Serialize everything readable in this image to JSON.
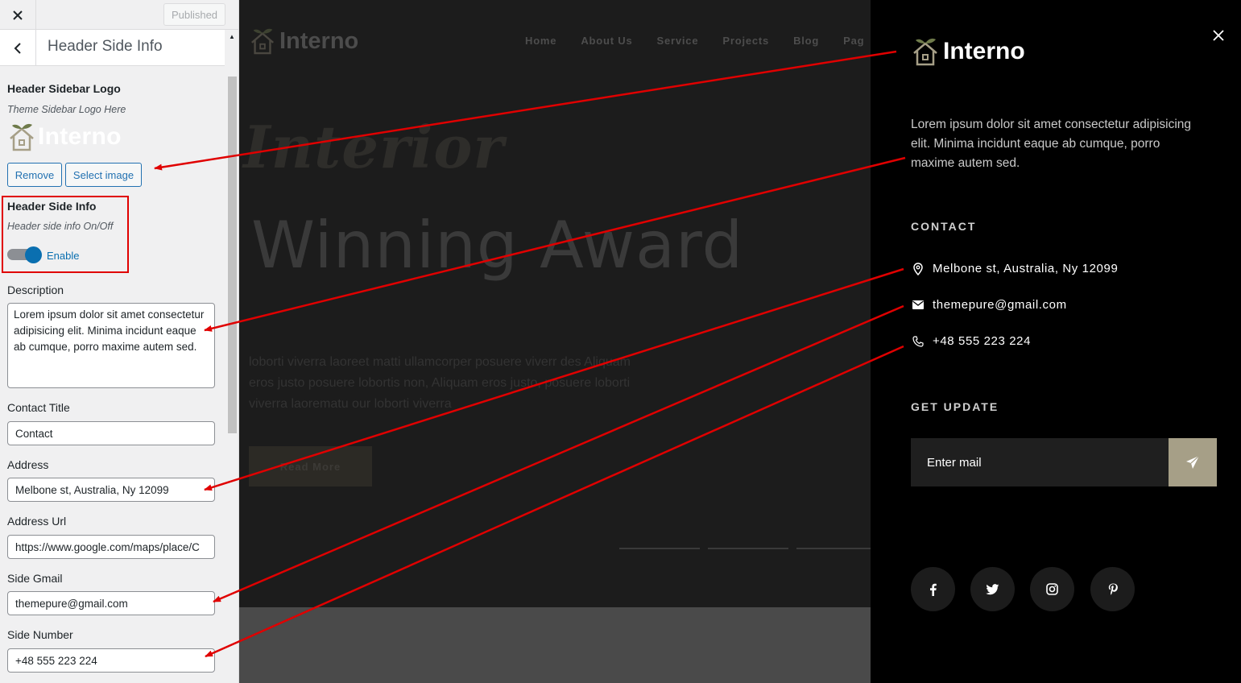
{
  "customizer": {
    "close_icon": "close-icon",
    "published_label": "Published",
    "section_title": "Header Side Info",
    "sidebar_logo": {
      "label": "Header Sidebar Logo",
      "description": "Theme Sidebar Logo Here",
      "logo_text": "Interno",
      "remove_label": "Remove",
      "select_label": "Select image"
    },
    "side_info": {
      "label": "Header Side Info",
      "description": "Header side info On/Off",
      "toggle_on": true,
      "toggle_label": "Enable"
    },
    "description": {
      "label": "Description",
      "value": "Lorem ipsum dolor sit amet consectetur adipisicing elit. Minima incidunt eaque ab cumque, porro maxime autem sed."
    },
    "contact_title": {
      "label": "Contact Title",
      "value": "Contact"
    },
    "address": {
      "label": "Address",
      "value": "Melbone st, Australia, Ny 12099"
    },
    "address_url": {
      "label": "Address Url",
      "value": "https://www.google.com/maps/place/C"
    },
    "side_gmail": {
      "label": "Side Gmail",
      "value": "themepure@gmail.com"
    },
    "side_number": {
      "label": "Side Number",
      "value": "+48 555 223 224"
    }
  },
  "preview": {
    "logo_text": "Interno",
    "nav": [
      "Home",
      "About Us",
      "Service",
      "Projects",
      "Blog",
      "Pag"
    ],
    "script_title": "Interior",
    "hero_title": "Winning Award",
    "paragraph": "loborti viverra laoreet matti ullamcorper posuere viverr des Aliquam eros justo posuere lobortis non, Aliquam eros justo, posuere loborti viverra laorematu our loborti viverra",
    "read_more": "Read More"
  },
  "side_info": {
    "logo_text": "Interno",
    "description": "Lorem ipsum dolor sit amet consectetur adipisicing elit. Minima incidunt eaque ab cumque, porro maxime autem sed.",
    "contact_heading": "CONTACT",
    "address": "Melbone st, Australia, Ny 12099",
    "email": "themepure@gmail.com",
    "phone": "+48 555 223 224",
    "update_heading": "GET UPDATE",
    "mail_placeholder": "Enter mail",
    "social": [
      "facebook-icon",
      "twitter-icon",
      "instagram-icon",
      "pinterest-icon"
    ],
    "accent_color": "#a69f87"
  },
  "annotation": {
    "arrow_color": "#e00000"
  }
}
